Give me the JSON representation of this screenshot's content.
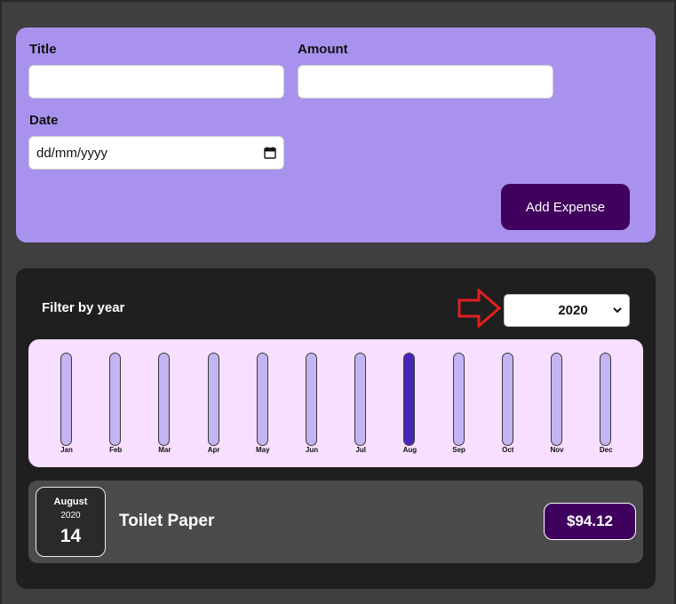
{
  "form": {
    "title_label": "Title",
    "title_value": "",
    "amount_label": "Amount",
    "amount_value": "",
    "date_label": "Date",
    "date_placeholder": "dd/mm/yyyy",
    "add_button_label": "Add Expense"
  },
  "filter": {
    "label": "Filter by year",
    "selected_year": "2020"
  },
  "chart_data": {
    "type": "bar",
    "categories": [
      "Jan",
      "Feb",
      "Mar",
      "Apr",
      "May",
      "Jun",
      "Jul",
      "Aug",
      "Sep",
      "Oct",
      "Nov",
      "Dec"
    ],
    "values": [
      0,
      0,
      0,
      0,
      0,
      0,
      0,
      94.12,
      0,
      0,
      0,
      0
    ],
    "title": "",
    "xlabel": "",
    "ylabel": ""
  },
  "expenses": [
    {
      "month": "August",
      "year": "2020",
      "day": "14",
      "title": "Toilet Paper",
      "amount": "$94.12"
    }
  ],
  "colors": {
    "form_bg": "#a892ee",
    "button_bg": "#40005d",
    "card_bg": "#1f1f1f",
    "chart_bg": "#f8dfff",
    "bar_empty": "#c3b4f3",
    "bar_fill": "#4826b9",
    "arrow": "#e21f1f"
  }
}
